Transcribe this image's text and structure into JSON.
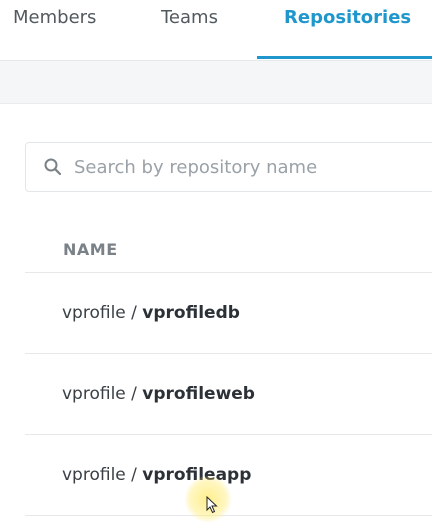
{
  "tabs": [
    {
      "label": "Members",
      "active": false
    },
    {
      "label": "Teams",
      "active": false
    },
    {
      "label": "Repositories",
      "active": true
    }
  ],
  "colors": {
    "accent": "#1f97cc",
    "band": "#f4f6f7",
    "border": "#e6e8ea"
  },
  "search": {
    "placeholder": "Search by repository name",
    "value": "",
    "icon": "search-icon"
  },
  "table": {
    "columns": [
      "NAME"
    ],
    "rows": [
      {
        "namespace": "vprofile / ",
        "repo": "vprofiledb"
      },
      {
        "namespace": "vprofile / ",
        "repo": "vprofileweb"
      },
      {
        "namespace": "vprofile / ",
        "repo": "vprofileapp"
      }
    ]
  }
}
